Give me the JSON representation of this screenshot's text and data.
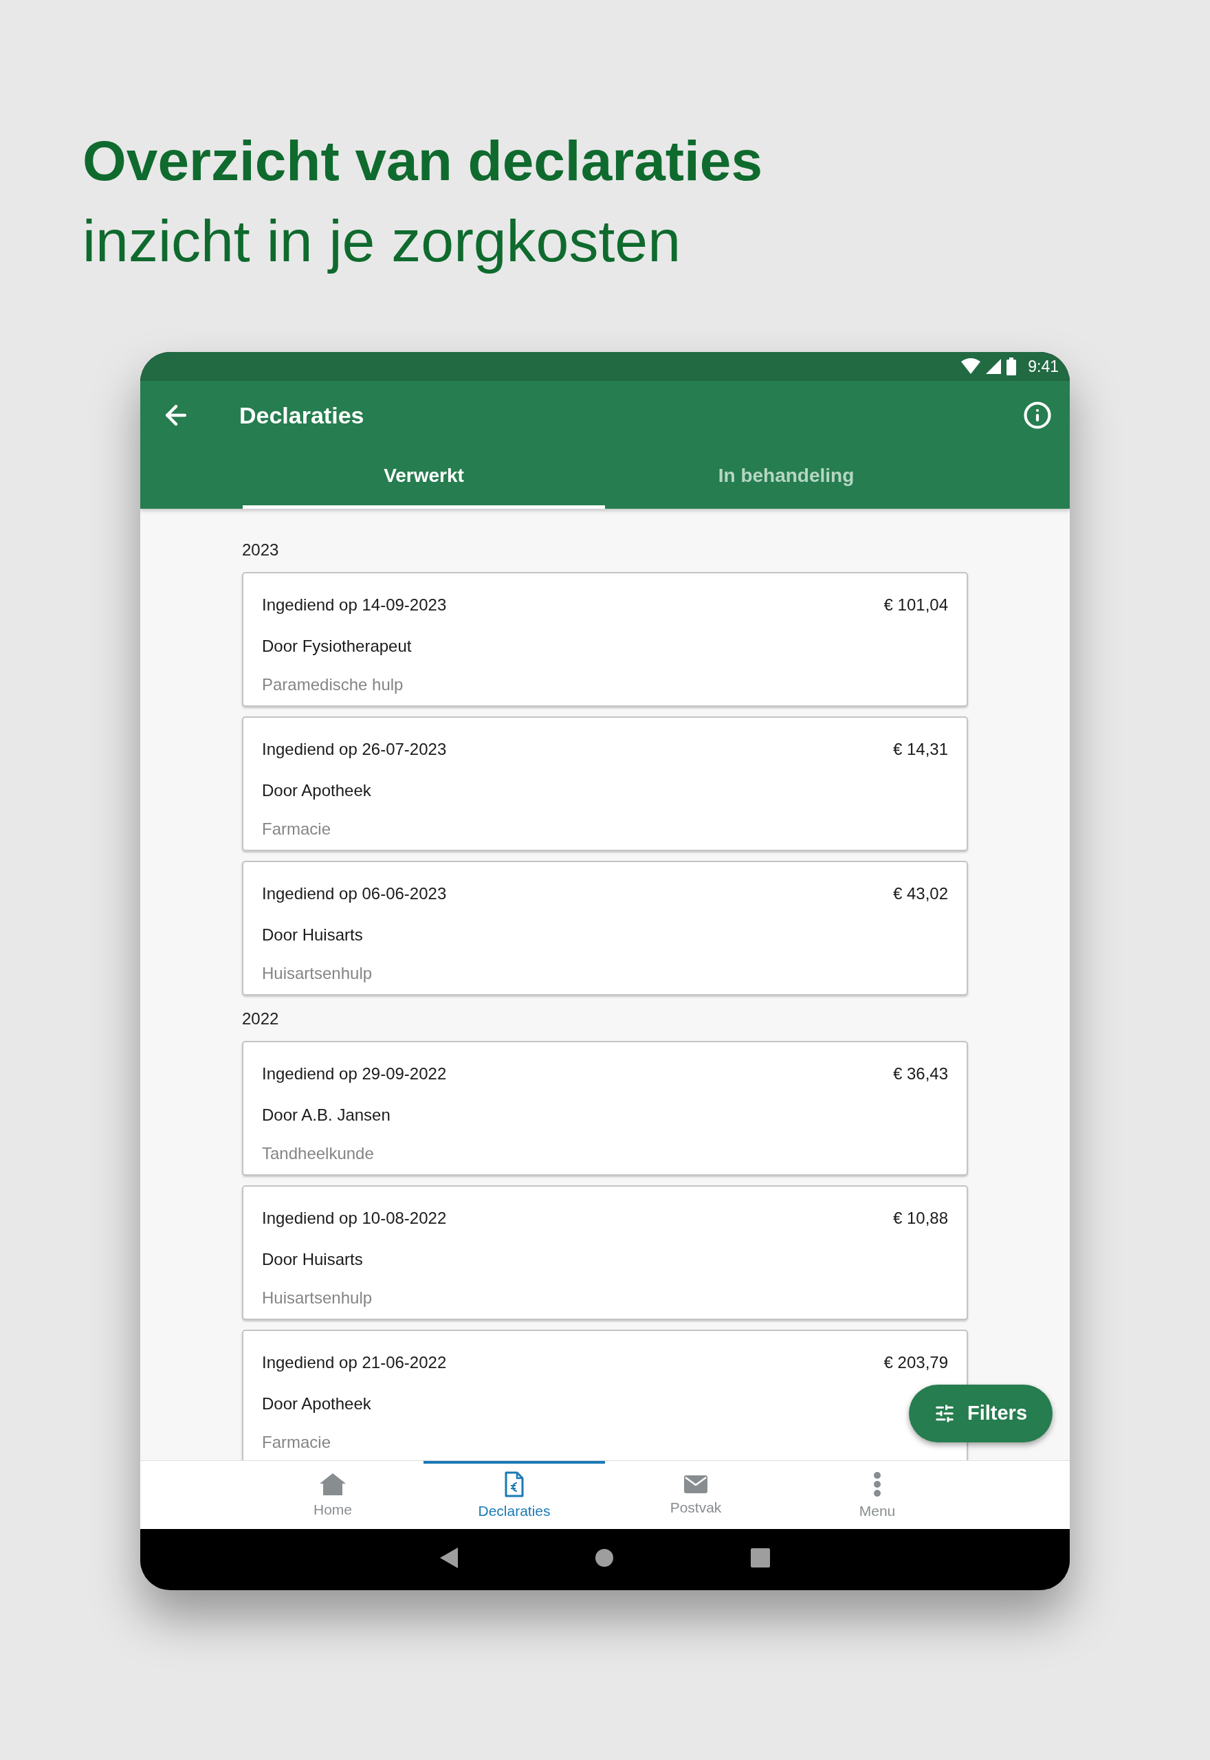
{
  "headline": {
    "title": "Overzicht van declaraties",
    "subtitle": "inzicht in je zorgkosten"
  },
  "status_bar": {
    "time": "9:41"
  },
  "app_bar": {
    "title": "Declaraties"
  },
  "tabs": [
    {
      "label": "Verwerkt",
      "selected": true
    },
    {
      "label": "In behandeling",
      "selected": false
    }
  ],
  "groups": [
    {
      "year": "2023",
      "claims": [
        {
          "submitted": "Ingediend op 14-09-2023",
          "amount": "€ 101,04",
          "provider": "Door Fysiotherapeut",
          "category": "Paramedische hulp"
        },
        {
          "submitted": "Ingediend op 26-07-2023",
          "amount": "€ 14,31",
          "provider": "Door Apotheek",
          "category": "Farmacie"
        },
        {
          "submitted": "Ingediend op 06-06-2023",
          "amount": "€ 43,02",
          "provider": "Door Huisarts",
          "category": "Huisartsenhulp"
        }
      ]
    },
    {
      "year": "2022",
      "claims": [
        {
          "submitted": "Ingediend op 29-09-2022",
          "amount": "€ 36,43",
          "provider": "Door A.B. Jansen",
          "category": "Tandheelkunde"
        },
        {
          "submitted": "Ingediend op 10-08-2022",
          "amount": "€ 10,88",
          "provider": "Door Huisarts",
          "category": "Huisartsenhulp"
        },
        {
          "submitted": "Ingediend op 21-06-2022",
          "amount": "€ 203,79",
          "provider": "Door Apotheek",
          "category": "Farmacie"
        }
      ]
    }
  ],
  "fab": {
    "label": "Filters"
  },
  "bottom_nav": [
    {
      "kind": "home",
      "label": "Home",
      "selected": false
    },
    {
      "kind": "claims",
      "label": "Declaraties",
      "selected": true
    },
    {
      "kind": "mail",
      "label": "Postvak",
      "selected": false
    },
    {
      "kind": "menu",
      "label": "Menu",
      "selected": false
    }
  ]
}
